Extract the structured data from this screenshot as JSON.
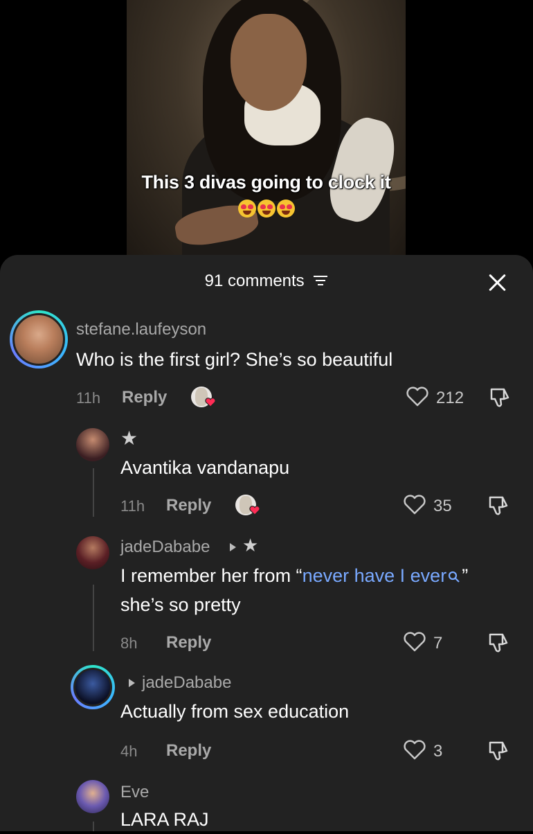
{
  "video": {
    "caption_line1": "This 3 divas going to clock it",
    "emoji": "😍😍😍"
  },
  "sheet": {
    "comment_count": "91 comments",
    "sort_icon": "filter-lines-icon",
    "close_icon": "close-icon"
  },
  "comments": [
    {
      "username": "stefane.laufeyson",
      "text": "Who is the first girl? She’s so beautiful",
      "time": "11h",
      "reply": "Reply",
      "likes": "212"
    },
    {
      "username": "★",
      "text": "Avantika vandanapu",
      "time": "11h",
      "reply": "Reply",
      "likes": "35"
    },
    {
      "username": "jadeDababe",
      "badge": "★",
      "text_before": "I remember her from “",
      "link": "never have I ever",
      "text_after": "” she’s so pretty",
      "time": "8h",
      "reply": "Reply",
      "likes": "7"
    },
    {
      "reply_to": "jadeDababe",
      "text": "Actually from sex education",
      "time": "4h",
      "reply": "Reply",
      "likes": "3"
    },
    {
      "username": "Eve",
      "text": "LARA RAJ"
    }
  ]
}
